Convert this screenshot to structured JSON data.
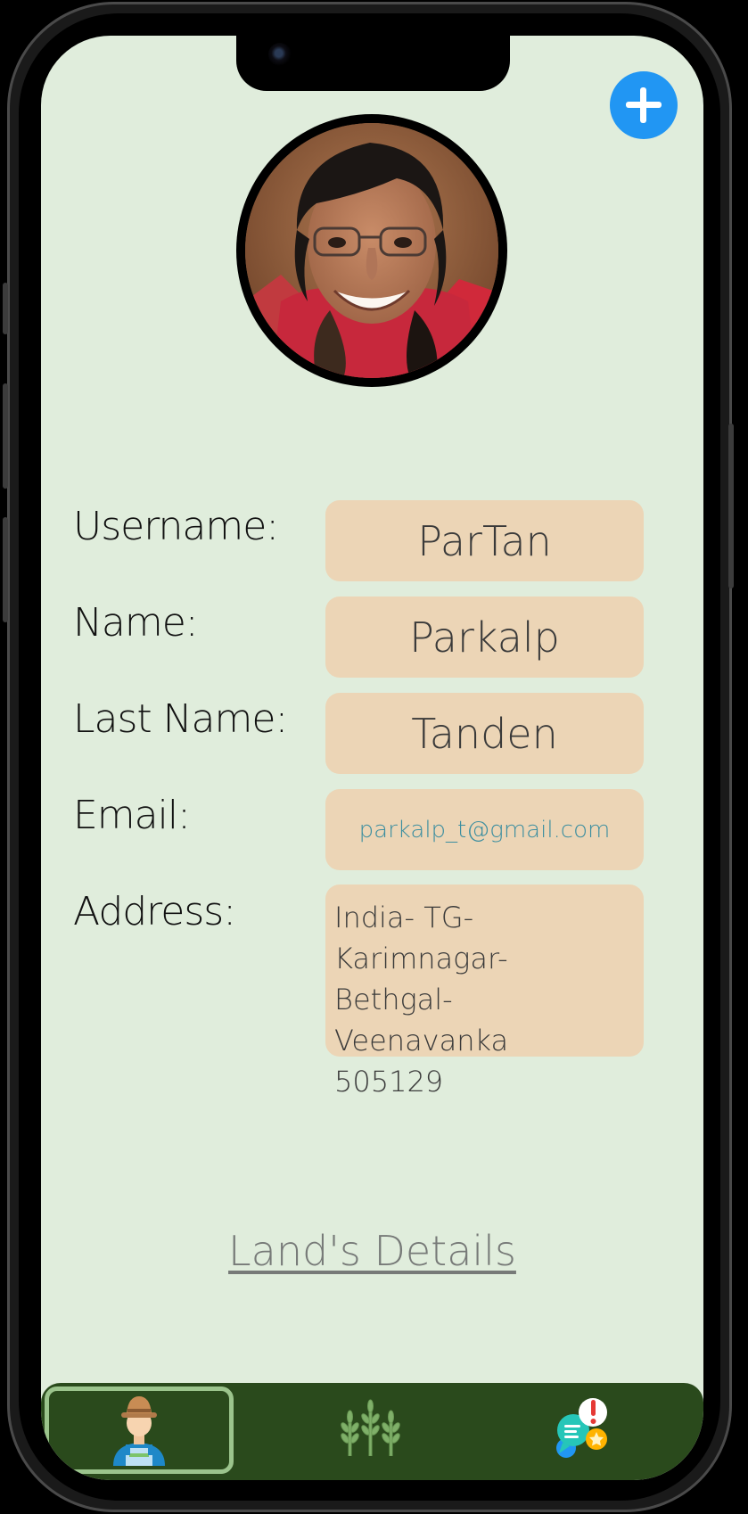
{
  "profile": {
    "add_button_icon": "plus-icon",
    "avatar_alt": "profile-photo"
  },
  "fields": {
    "username_label": "Username:",
    "username_value": "ParTan",
    "name_label": "Name:",
    "name_value": "Parkalp",
    "last_name_label": "Last Name:",
    "last_name_value": "Tanden",
    "email_label": "Email:",
    "email_value": "parkalp_t@gmail.com",
    "address_label": "Address:",
    "address_value": "India- TG- Karimnagar-\nBethgal- Veenavanka\n505129"
  },
  "links": {
    "lands_details": "Land's Details"
  },
  "bottom_nav": {
    "items": [
      {
        "icon": "farmer-icon",
        "active": true
      },
      {
        "icon": "wheat-icon",
        "active": false
      },
      {
        "icon": "chat-alert-icon",
        "active": false
      }
    ]
  },
  "colors": {
    "screen_bg": "#e0eddc",
    "field_bg": "#ecd5b6",
    "accent_blue": "#2196f3",
    "nav_bg": "#2a4a1c",
    "nav_active_border": "#9bc48c",
    "email_text": "#3c8ea0"
  }
}
